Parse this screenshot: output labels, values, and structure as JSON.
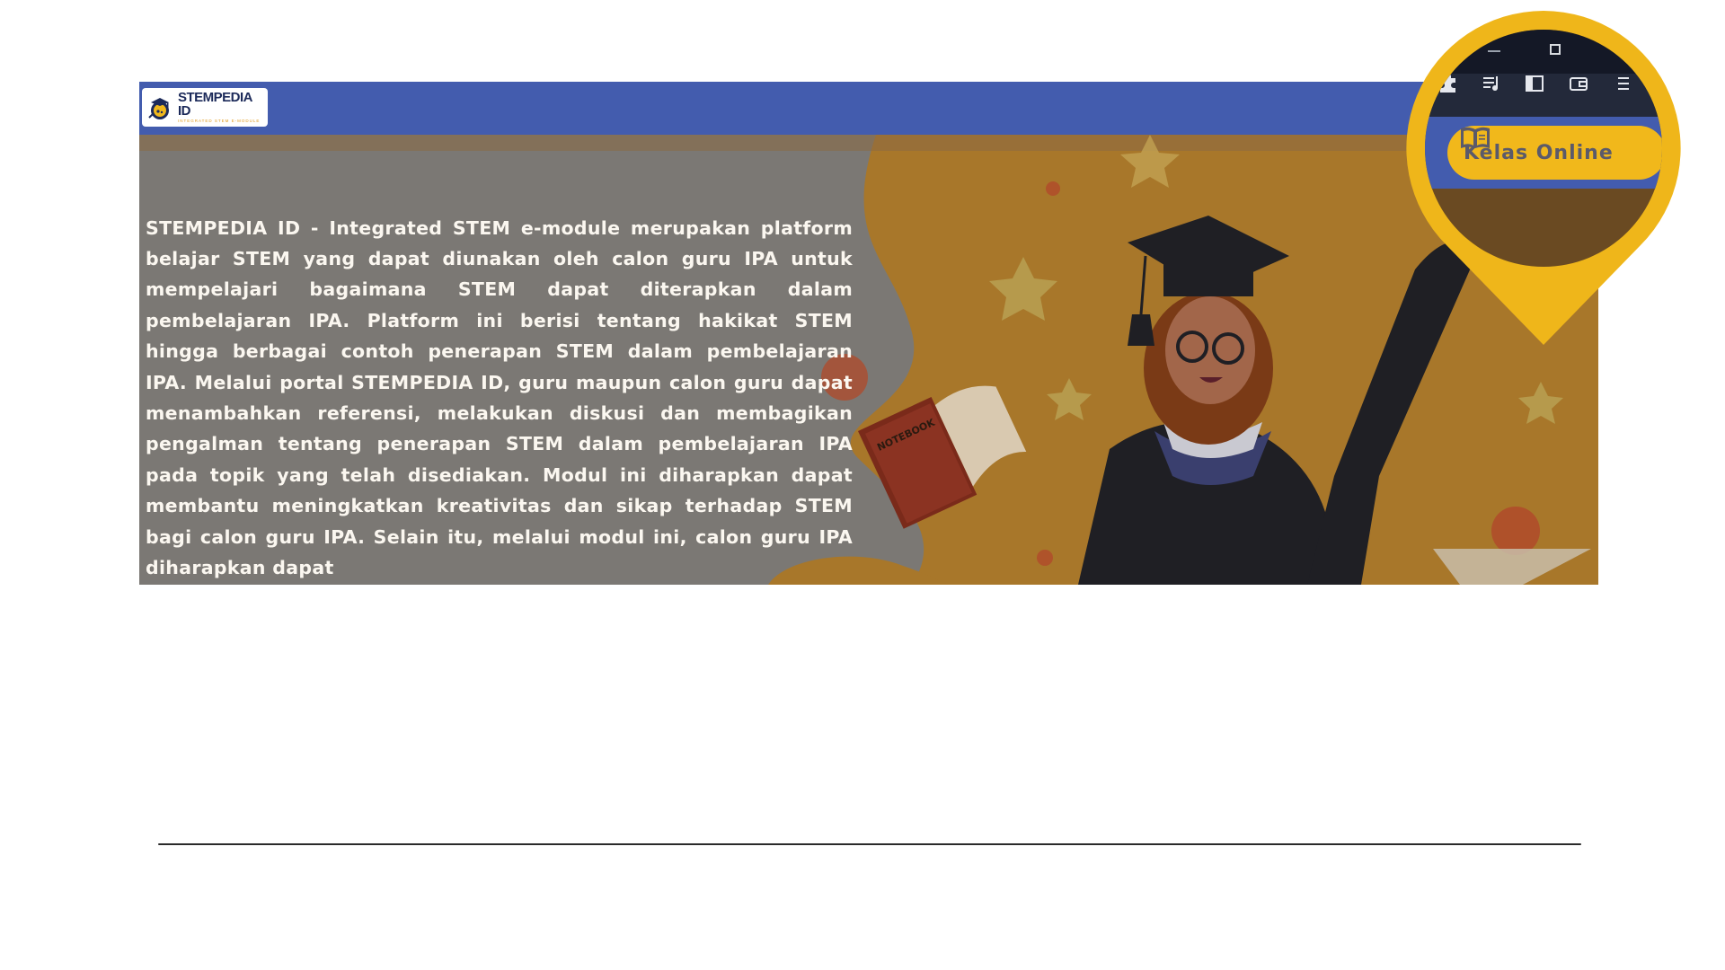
{
  "brand": {
    "name": "STEMPEDIA ID",
    "tagline": "INTEGRATED STEM E-MODULE",
    "logo_icon": "graduation-flask-logo"
  },
  "hero": {
    "description": "STEMPEDIA ID - Integrated STEM e-module merupakan platform belajar STEM yang dapat diunakan oleh calon guru IPA untuk mempelajari bagaimana STEM dapat diterapkan dalam pembelajaran IPA. Platform ini berisi tentang hakikat STEM hingga berbagai contoh penerapan STEM dalam pembelajaran IPA. Melalui portal STEMPEDIA ID, guru maupun calon guru dapat menambahkan referensi, melakukan diskusi dan membagikan pengalman tentang penerapan STEM dalam pembelajaran IPA pada topik yang telah disediakan. Modul ini diharapkan dapat membantu meningkatkan kreativitas dan sikap terhadap STEM bagi calon guru IPA. Selain itu, melalui modul ini, calon guru IPA diharapkan dapat",
    "notebook_label": "NOTEBOOK"
  },
  "callout": {
    "button_label": "Kelas Online",
    "button_icon": "book-icon",
    "toolbar_icons": [
      "extensions-icon",
      "media-playlist-icon",
      "side-panel-icon",
      "wallet-icon",
      "menu-icon"
    ],
    "window_controls": [
      "minimize-icon",
      "maximize-icon"
    ]
  },
  "colors": {
    "navbar": "#435cae",
    "accent_yellow": "#f1b81b",
    "hero_overlay": "#7b7874",
    "hero_art": "#b07a20"
  }
}
